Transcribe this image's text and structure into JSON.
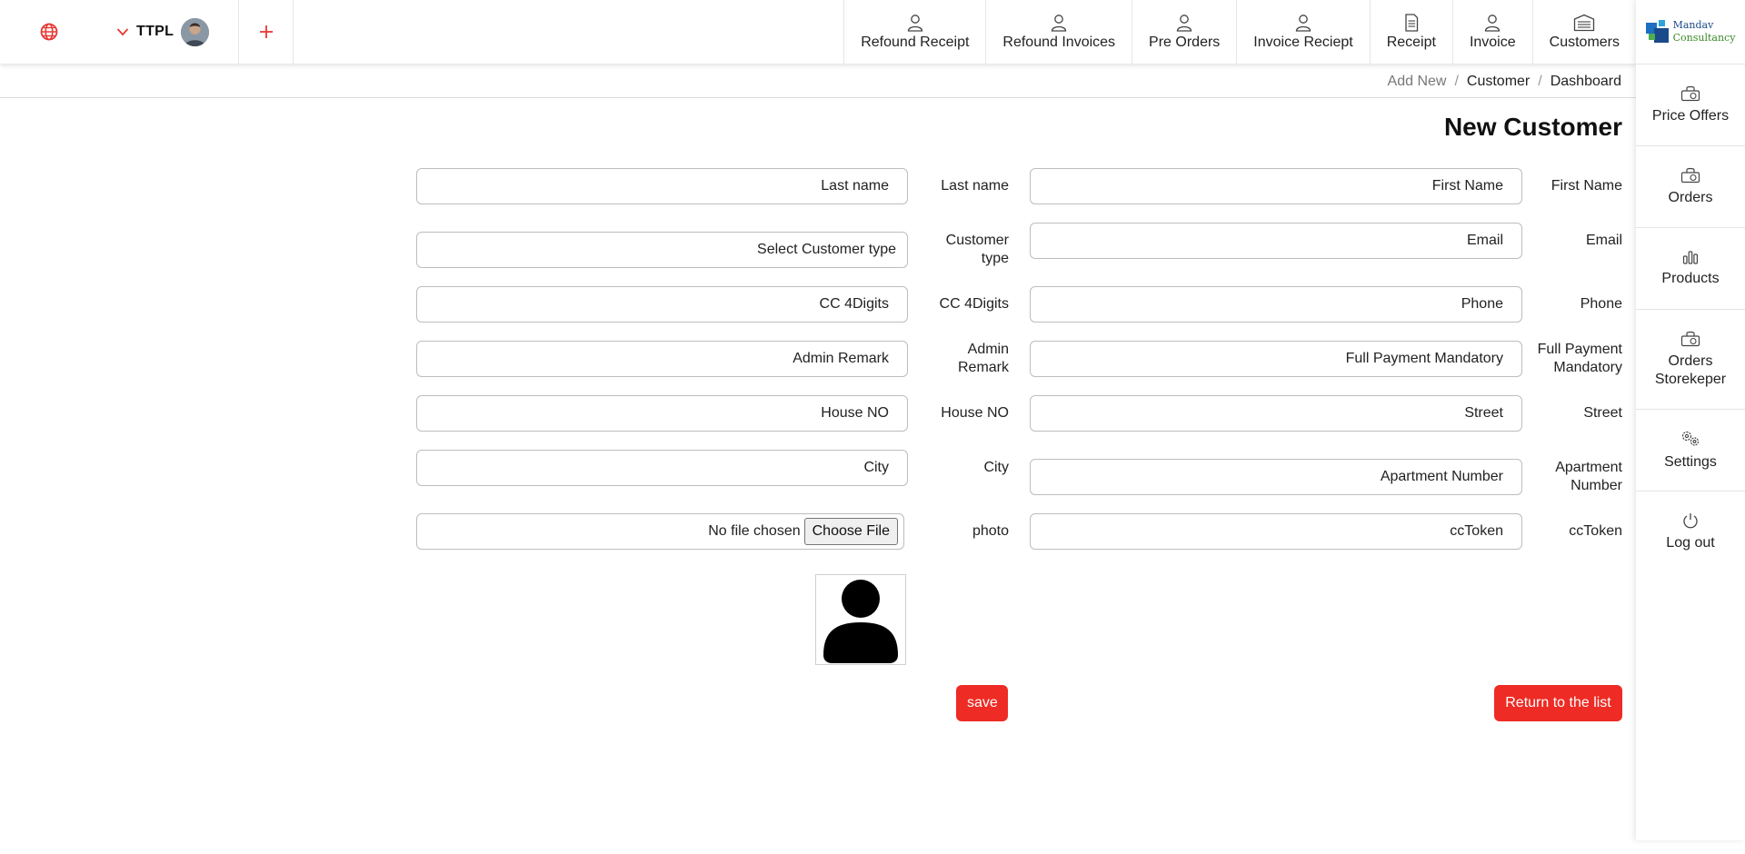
{
  "topbar": {
    "user": "TTPL",
    "nav": [
      {
        "label": "Refound Receipt",
        "icon": "user-icon"
      },
      {
        "label": "Refound Invoices",
        "icon": "user-icon"
      },
      {
        "label": "Pre Orders",
        "icon": "user-icon"
      },
      {
        "label": "Invoice Reciept",
        "icon": "user-icon"
      },
      {
        "label": "Receipt",
        "icon": "document-icon"
      },
      {
        "label": "Invoice",
        "icon": "user-icon"
      },
      {
        "label": "Customers",
        "icon": "warehouse-icon"
      }
    ]
  },
  "sidebar": {
    "logo": {
      "line1": "Mandav",
      "line2": "Consultancy"
    },
    "items": [
      {
        "label": "Price Offers",
        "icon": "basket-icon"
      },
      {
        "label": "Orders",
        "icon": "basket-icon"
      },
      {
        "label": "Products",
        "icon": "bar-chart-icon"
      },
      {
        "label": "Orders Storekeper",
        "icon": "basket-icon"
      },
      {
        "label": "Settings",
        "icon": "gears-icon"
      },
      {
        "label": "Log out",
        "icon": "power-icon"
      }
    ]
  },
  "breadcrumb": [
    "Dashboard",
    "Customer",
    "Add New"
  ],
  "form": {
    "title": "New Customer",
    "fields": {
      "first_name": {
        "label": "First Name",
        "placeholder": "First Name"
      },
      "last_name": {
        "label": "Last name",
        "placeholder": "Last name"
      },
      "email": {
        "label": "Email",
        "placeholder": "Email"
      },
      "customer_type": {
        "label": "Customer type",
        "placeholder": "Select Customer type"
      },
      "phone": {
        "label": "Phone",
        "placeholder": "Phone"
      },
      "cc4": {
        "label": "CC 4Digits",
        "placeholder": "CC 4Digits"
      },
      "full_payment": {
        "label": "Full Payment Mandatory",
        "placeholder": "Full Payment Mandatory"
      },
      "admin_remark": {
        "label": "Admin Remark",
        "placeholder": "Admin Remark"
      },
      "street": {
        "label": "Street",
        "placeholder": "Street"
      },
      "house_no": {
        "label": "House NO",
        "placeholder": "House NO"
      },
      "apartment": {
        "label": "Apartment Number",
        "placeholder": "Apartment Number"
      },
      "city": {
        "label": "City",
        "placeholder": "City"
      },
      "cctoken": {
        "label": "ccToken",
        "placeholder": "ccToken"
      },
      "photo": {
        "label": "photo",
        "no_file": "No file chosen",
        "choose": "Choose File"
      }
    },
    "save": "save",
    "return": "Return to the list"
  },
  "colors": {
    "accent": "#ee2b24",
    "logo_blue": "#1a4a8a",
    "logo_green": "#3a8a2a"
  }
}
